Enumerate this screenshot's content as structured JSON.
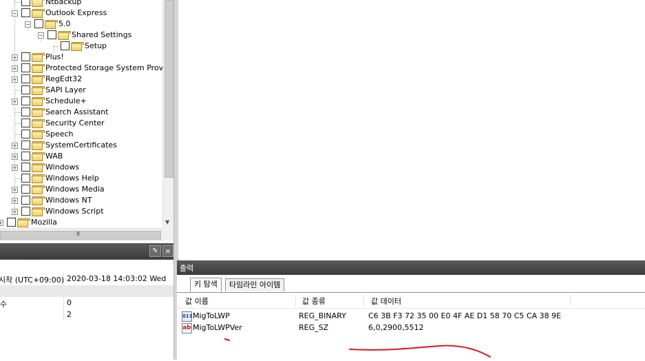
{
  "tree": {
    "nodes": [
      {
        "label": "Ntbackup"
      },
      {
        "label": "Outlook Express"
      },
      {
        "label": "5.0"
      },
      {
        "label": "Shared Settings"
      },
      {
        "label": "Setup"
      },
      {
        "label": "Plus!"
      },
      {
        "label": "Protected Storage System Provider"
      },
      {
        "label": "RegEdt32"
      },
      {
        "label": "SAPI Layer"
      },
      {
        "label": "Schedule+"
      },
      {
        "label": "Search Assistant"
      },
      {
        "label": "Security Center"
      },
      {
        "label": "Speech"
      },
      {
        "label": "SystemCertificates"
      },
      {
        "label": "WAB"
      },
      {
        "label": "Windows"
      },
      {
        "label": "Windows Help"
      },
      {
        "label": "Windows Media"
      },
      {
        "label": "Windows NT"
      },
      {
        "label": "Windows Script"
      },
      {
        "label": "Mozilla"
      }
    ],
    "hscroll_grip": "III"
  },
  "properties": {
    "pin_icon": "pin-icon",
    "close_icon": "close-icon",
    "close_glyph": "×",
    "rows": [
      {
        "key": "시작 (UTC+09:00)",
        "value": "2020-03-18  14:03:02  Wed"
      },
      {
        "key": "",
        "value": ""
      },
      {
        "key": "수",
        "value": "0"
      },
      {
        "key": "",
        "value": "2"
      }
    ]
  },
  "output": {
    "title": "출력",
    "tabs": [
      {
        "label": "키 탐색",
        "active": true
      },
      {
        "label": "타임라인 아이템",
        "active": false
      }
    ],
    "columns": {
      "name": "값 이름",
      "type": "값 종류",
      "data": "값 데이터"
    },
    "rows": [
      {
        "icon": "binary-value-icon",
        "icon_text": "011",
        "name": "MigToLWP",
        "type": "REG_BINARY",
        "data": "C6 3B F3 72 35 00 E0 4F AE D1 58 70 C5 CA 38 9E"
      },
      {
        "icon": "string-value-icon",
        "icon_text": "ab",
        "name": "MigToLWPVer",
        "type": "REG_SZ",
        "data": "6,0,2900,5512"
      }
    ]
  },
  "colors": {
    "panel_header": "#3c3c3c",
    "annotation_red": "#e0141e",
    "folder_yellow": "#f2cf5e"
  }
}
